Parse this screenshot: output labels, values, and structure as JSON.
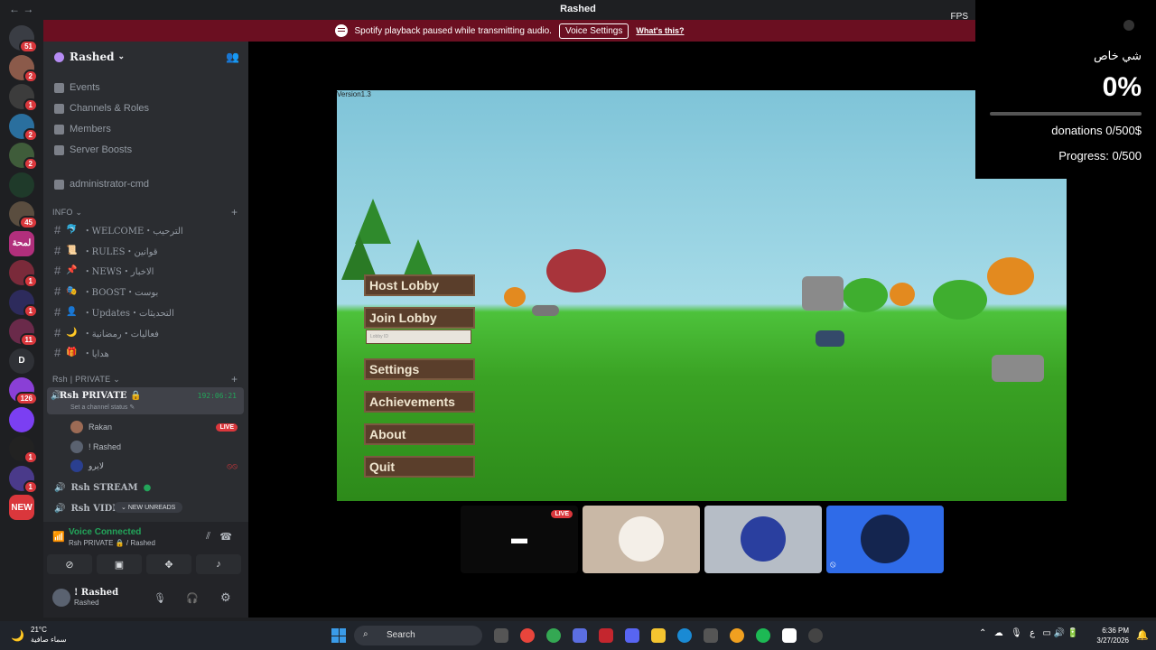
{
  "window": {
    "title": "Rashed",
    "nav": "←  →",
    "fps_label": "FPS"
  },
  "notice": {
    "text": "Spotify playback paused while transmitting audio.",
    "button": "Voice Settings",
    "link": "What's this?"
  },
  "servers": [
    {
      "label": "",
      "badge": "51",
      "color": "#3a3d44"
    },
    {
      "label": "",
      "badge": "2",
      "color": "#8b5a4a"
    },
    {
      "label": "",
      "badge": "1",
      "color": "#3c3c3c"
    },
    {
      "label": "",
      "badge": "2",
      "color": "#2a6f9e"
    },
    {
      "label": "",
      "badge": "2",
      "color": "#3f5c3a"
    },
    {
      "label": "",
      "badge": "",
      "color": "#1f3a2a"
    },
    {
      "label": "",
      "badge": "45",
      "color": "#5a4d3f"
    },
    {
      "label": "لمحة",
      "badge": "",
      "color": "#b12f7c"
    },
    {
      "label": "",
      "badge": "1",
      "color": "#7a2a3a"
    },
    {
      "label": "",
      "badge": "1",
      "color": "#2d2b5c"
    },
    {
      "label": "",
      "badge": "11",
      "color": "#6a2a4a"
    },
    {
      "label": "D",
      "badge": "",
      "color": "#2f3136"
    },
    {
      "label": "",
      "badge": "126",
      "color": "#8a3fd6"
    },
    {
      "label": "",
      "badge": "",
      "color": "#7b3ff2"
    },
    {
      "label": "",
      "badge": "1",
      "color": "#222"
    },
    {
      "label": "",
      "badge": "1",
      "color": "#4a3a8a"
    },
    {
      "label": "NEW",
      "badge": "",
      "color": "#da373c"
    }
  ],
  "guild": {
    "name": "Rashed"
  },
  "menu": [
    "Events",
    "Channels & Roles",
    "Members",
    "Server Boosts"
  ],
  "channels_top": [
    {
      "name": "administrator-cmd"
    }
  ],
  "categories": {
    "info": "INFO",
    "private": "Rsh | PRIVATE"
  },
  "info_channels": [
    {
      "emoji": "🐬",
      "name": "・WELCOME・الترحيب"
    },
    {
      "emoji": "📜",
      "name": "・RULES・قوانين"
    },
    {
      "emoji": "📌",
      "name": "・NEWS・الاخبار"
    },
    {
      "emoji": "🎭",
      "name": "・BOOST・بوست"
    },
    {
      "emoji": "👤",
      "name": "・Updates・التحديثات"
    },
    {
      "emoji": "🌙",
      "name": "・فعاليات・رمضانية"
    },
    {
      "emoji": "🎁",
      "name": "・هدايا"
    }
  ],
  "voice": {
    "channel": "Rsh PRIVATE 🔒",
    "status": "Set a channel status ✎",
    "timer": "192:06:21",
    "users": [
      {
        "name": "Rakan",
        "live": "LIVE"
      },
      {
        "name": "! Rashed",
        "live": ""
      },
      {
        "name": "لايرو",
        "live": ""
      }
    ]
  },
  "other_voice": [
    {
      "name": "Rsh STREAM"
    },
    {
      "name": "Rsh VIDE"
    }
  ],
  "unreads": "NEW UNREADS",
  "panel": {
    "connected": "Voice Connected",
    "location": "Rsh PRIVATE 🔒 / Rashed",
    "user": "! Rashed",
    "user_status": "Rashed"
  },
  "game": {
    "version": "Version1.3",
    "buttons": [
      "Host Lobby",
      "Join Lobby",
      "Settings",
      "Achievements",
      "About",
      "Quit"
    ],
    "lobby_placeholder": "Lobby ID"
  },
  "tiles": {
    "live": "LIVE"
  },
  "overlay": {
    "title": "شي خاص",
    "percent": "0%",
    "progress_fraction": 0,
    "donations": "donations 0/500$",
    "progress": "Progress: 0/500"
  },
  "taskbar": {
    "temp": "21°C",
    "weather": "سماء صافية",
    "search": "Search",
    "time": "6:36 PM",
    "date": "3/27/2026",
    "lang": "ع"
  }
}
